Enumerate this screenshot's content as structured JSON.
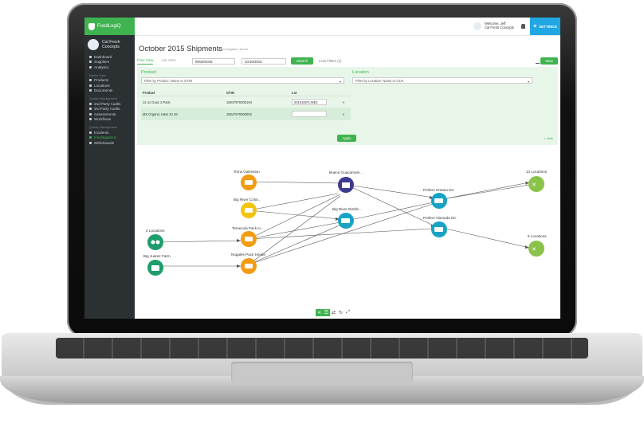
{
  "brand": {
    "name": "FoodLogiQ"
  },
  "org": {
    "name_line1": "Cal Fresh",
    "name_line2": "Concepts"
  },
  "sidebar": {
    "items_top": [
      {
        "label": "Dashboard",
        "icon": "dashboard-icon"
      },
      {
        "label": "Suppliers",
        "icon": "suppliers-icon"
      },
      {
        "label": "Analytics",
        "icon": "analytics-icon"
      }
    ],
    "section1": "Master Data",
    "items_master": [
      {
        "label": "Products",
        "icon": "products-icon"
      },
      {
        "label": "Locations",
        "icon": "locations-icon"
      },
      {
        "label": "Documents",
        "icon": "documents-icon"
      }
    ],
    "section2": "Quality Management",
    "items_quality": [
      {
        "label": "2nd Party Audits",
        "icon": "audit-icon"
      },
      {
        "label": "3rd Party Audits",
        "icon": "audit-icon"
      },
      {
        "label": "Assessments",
        "icon": "assessment-icon"
      },
      {
        "label": "Workflows",
        "icon": "workflow-icon"
      }
    ],
    "section3": "Quality Management",
    "items_incidents": [
      {
        "label": "Incidents",
        "icon": "incident-icon"
      },
      {
        "label": "Investigations",
        "icon": "investigation-icon",
        "active": true
      },
      {
        "label": "Withdrawals",
        "icon": "withdrawal-icon"
      }
    ]
  },
  "topbar": {
    "welcome": "Welcome, Jeff",
    "company": "Cal Fresh Concepts",
    "settings": "SETTINGS"
  },
  "page": {
    "title": "October 2015 Shipments",
    "edit_label": "Edit Investigation Name"
  },
  "views": {
    "flow": "Flow View",
    "list": "List View"
  },
  "dates": {
    "from": "09/28/2015",
    "to": "10/16/2015"
  },
  "search_label": "Search",
  "less_filters": "Less Filters (2)",
  "save_label": "Save",
  "filters": {
    "product_title": "Product",
    "product_placeholder": "Filter by Product: Name or GTIN",
    "location_title": "Location",
    "location_placeholder": "Filter by Location: Name or GLN",
    "columns": [
      "Product",
      "GTIN",
      "Lot"
    ],
    "rows": [
      {
        "product": "12 oz Guac 2 Pack",
        "gtin": "10847970000194",
        "lot": "20151007LINE2"
      },
      {
        "product": "MX Organic Hass Sz 48",
        "gtin": "10847970000002",
        "lot": ""
      }
    ],
    "apply_label": "Apply",
    "hide_label": "Hide"
  },
  "colors": {
    "green": "#3fb34f",
    "orange": "#f39c12",
    "purple": "#3d3b8f",
    "teal": "#18a3c5",
    "light_green": "#8bc34a",
    "dark_green": "#1f9c6b"
  },
  "flow": {
    "nodes": {
      "toms": "Toms Galveston",
      "bigriver_color": "Big River Color...",
      "temecula": "Temecula Pack H...",
      "nogales": "Nogales Pack House",
      "two_loc": "2 Locations",
      "juarez": "Big Juarez Farm",
      "bueno": "Bueno Guacamole...",
      "bigriver_dist": "Big River Distrib...",
      "ontario": "Perfect Ontario DC",
      "alameda": "Perfect Alameda DC",
      "thirteen": "13 Locations",
      "five": "5 Locations"
    }
  }
}
